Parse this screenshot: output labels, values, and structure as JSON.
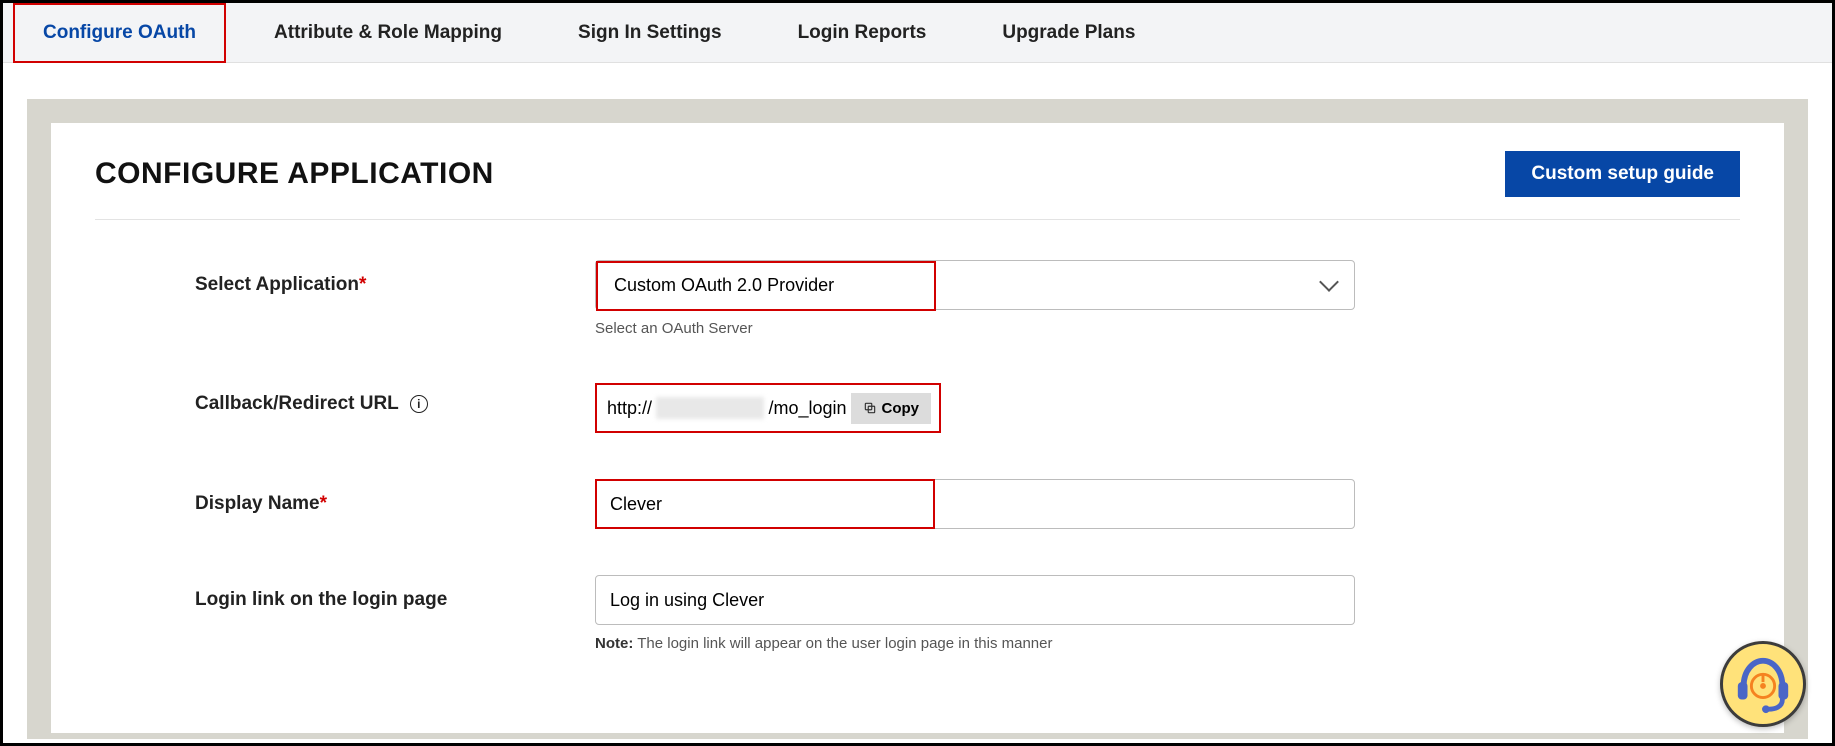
{
  "tabs": {
    "configure_oauth": "Configure OAuth",
    "attribute_role_mapping": "Attribute & Role Mapping",
    "sign_in_settings": "Sign In Settings",
    "login_reports": "Login Reports",
    "upgrade_plans": "Upgrade Plans"
  },
  "panel": {
    "title": "CONFIGURE APPLICATION",
    "guide_btn": "Custom setup guide"
  },
  "form": {
    "select_app": {
      "label": "Select Application",
      "value": "Custom OAuth 2.0 Provider",
      "helper": "Select an OAuth Server"
    },
    "callback": {
      "label": "Callback/Redirect URL",
      "url_prefix": "http://",
      "url_suffix": "/mo_login",
      "copy_label": "Copy"
    },
    "display_name": {
      "label": "Display Name",
      "value": "Clever"
    },
    "login_link": {
      "label": "Login link on the login page",
      "value": "Log in using Clever",
      "note_bold": "Note:",
      "note_text": " The login link will appear on the user login page in this manner"
    }
  }
}
